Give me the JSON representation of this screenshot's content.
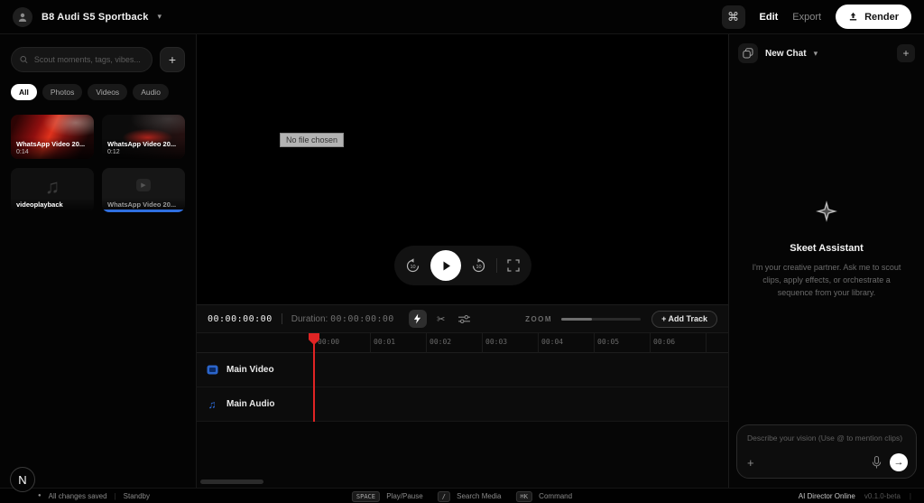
{
  "topbar": {
    "project_title": "B8 Audi S5 Sportback",
    "edit_label": "Edit",
    "export_label": "Export",
    "render_label": "Render",
    "command_glyph": "⌘"
  },
  "library": {
    "search_placeholder": "Scout moments, tags, vibes...",
    "add_label": "+",
    "filters": [
      {
        "label": "All"
      },
      {
        "label": "Photos"
      },
      {
        "label": "Videos"
      },
      {
        "label": "Audio"
      }
    ],
    "items": [
      {
        "label": "WhatsApp Video 20...",
        "duration": "0:14"
      },
      {
        "label": "WhatsApp Video 20...",
        "duration": "0:12"
      },
      {
        "label": "videoplayback",
        "duration": ""
      },
      {
        "label": "WhatsApp Video 20...",
        "duration": ""
      }
    ]
  },
  "preview": {
    "file_input_label": "No file chosen"
  },
  "timeline": {
    "timecode": "00:00:00:00",
    "duration_label": "Duration:",
    "duration_value": "00:00:00:00",
    "zoom_label": "ZOOM",
    "add_track_label": "+ Add Track",
    "ruler": [
      "00:00",
      "00:01",
      "00:02",
      "00:03",
      "00:04",
      "00:05",
      "00:06"
    ],
    "tracks": [
      {
        "label": "Main Video"
      },
      {
        "label": "Main Audio"
      }
    ]
  },
  "assistant": {
    "chat_title": "New Chat",
    "new_chat_plus": "+",
    "name": "Skeet Assistant",
    "description": "I'm your creative partner. Ask me to scout clips, apply effects, or orchestrate a sequence from your library.",
    "input_placeholder": "Describe your vision (Use @ to mention clips)",
    "attach_label": "+",
    "send_glyph": "→"
  },
  "statusbar": {
    "saved": "All changes saved",
    "standby": "Standby",
    "shortcuts": [
      {
        "key": "SPACE",
        "label": "Play/Pause"
      },
      {
        "key": "/",
        "label": "Search Media"
      },
      {
        "key": "⌘K",
        "label": "Command"
      }
    ],
    "director": "AI Director Online",
    "version": "v0.1.0-beta"
  },
  "badge": {
    "letter": "N"
  },
  "colors": {
    "accent_red": "#e02424",
    "accent_blue": "#2f6fe0",
    "render_bg": "#ffffff"
  }
}
